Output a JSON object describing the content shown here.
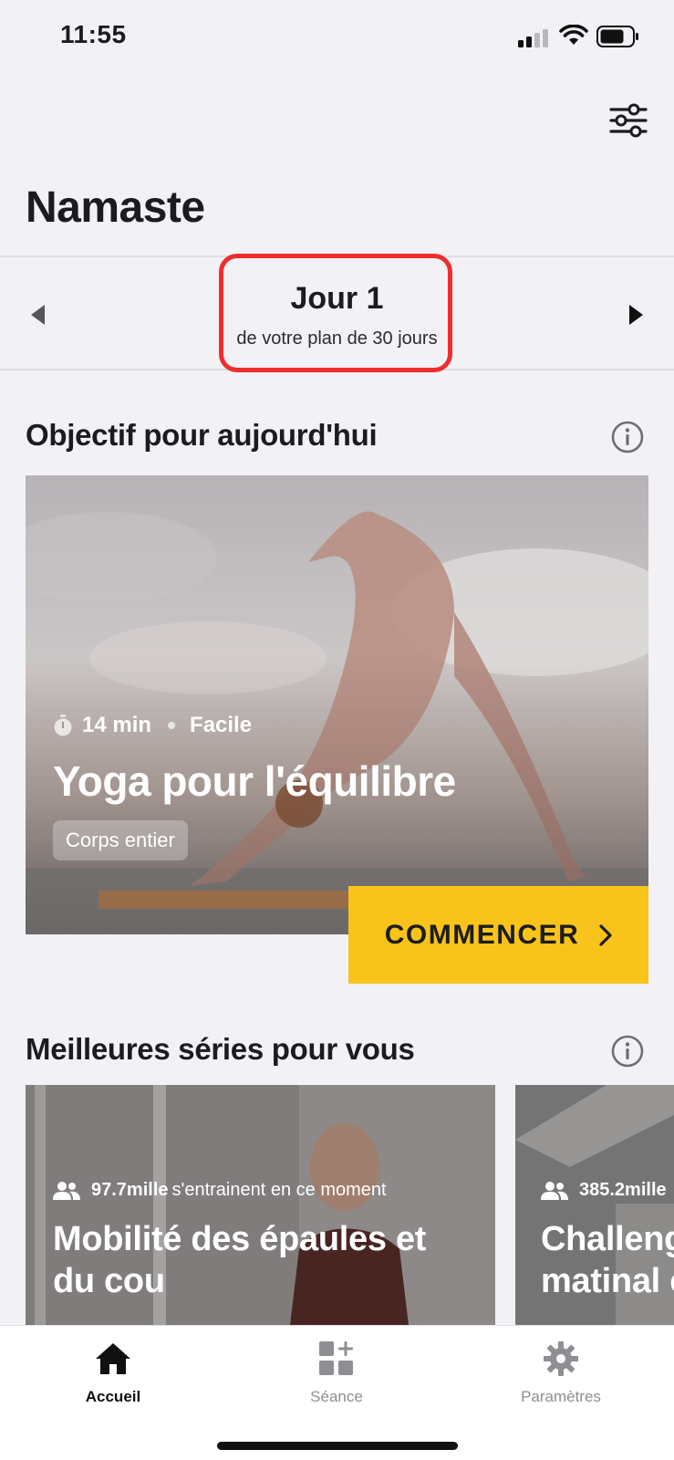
{
  "status_bar": {
    "time": "11:55"
  },
  "header": {
    "title": "Namaste",
    "settings_icon": "sliders-icon"
  },
  "day_selector": {
    "title": "Jour 1",
    "subtitle": "de votre plan de 30 jours",
    "highlight_color": "#ef2d2d"
  },
  "goal_section": {
    "title": "Objectif pour aujourd'hui",
    "card": {
      "duration": "14 min",
      "difficulty": "Facile",
      "title": "Yoga pour l'équilibre",
      "tag": "Corps entier",
      "start_label": "COMMENCER"
    }
  },
  "series_section": {
    "title": "Meilleures séries pour vous",
    "cards": [
      {
        "count": "97.7mille",
        "count_suffix": "s'entrainent en ce moment",
        "title": "Mobilité des épaules et du cou"
      },
      {
        "count": "385.2mille",
        "count_suffix": "",
        "title": "Challenge matinal e"
      }
    ]
  },
  "tab_bar": {
    "tabs": [
      {
        "label": "Accueil",
        "icon": "home-icon",
        "active": true
      },
      {
        "label": "Séance",
        "icon": "add-grid-icon",
        "active": false
      },
      {
        "label": "Paramètres",
        "icon": "gear-icon",
        "active": false
      }
    ]
  },
  "colors": {
    "accent": "#f8c31b",
    "background": "#f2f1f6",
    "highlight": "#ef2d2d"
  }
}
